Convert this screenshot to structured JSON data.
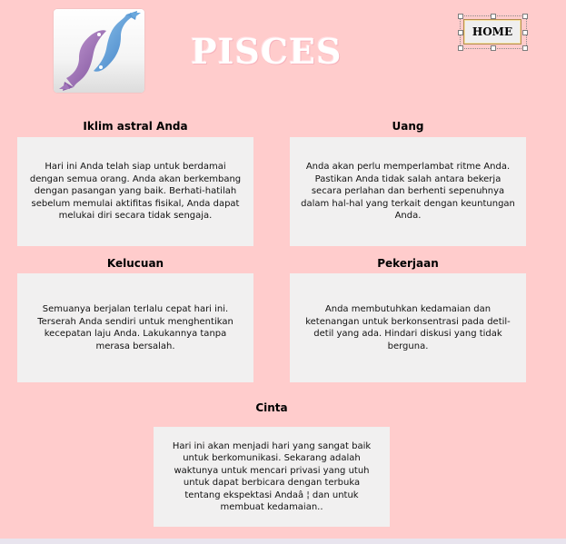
{
  "header": {
    "title": "PISCES",
    "home_label": "HOME"
  },
  "sections": [
    {
      "heading": "Iklim astral Anda",
      "body": "Hari ini Anda telah siap untuk berdamai dengan semua orang. Anda akan berkembang dengan pasangan yang baik. Berhati-hatilah sebelum memulai aktifitas fisikal, Anda dapat melukai diri secara tidak sengaja."
    },
    {
      "heading": "Uang",
      "body": "Anda akan perlu memperlambat ritme Anda. Pastikan Anda tidak salah antara bekerja secara perlahan dan berhenti sepenuhnya dalam hal-hal yang terkait dengan keuntungan Anda."
    },
    {
      "heading": "Kelucuan",
      "body": "Semuanya berjalan terlalu cepat hari ini. Terserah Anda sendiri untuk menghentikan kecepatan laju Anda. Lakukannya tanpa merasa bersalah."
    },
    {
      "heading": "Pekerjaan",
      "body": "Anda membutuhkan kedamaian dan ketenangan untuk berkonsentrasi pada detil-detil yang ada. Hindari diskusi yang tidak berguna."
    },
    {
      "heading": "Cinta",
      "body": "Hari ini akan menjadi hari yang sangat baik untuk berkomunikasi. Sekarang adalah waktunya untuk mencari privasi yang utuh untuk dapat berbicara dengan terbuka tentang ekspektasi Andaâ ¦ dan untuk membuat kedamaian.."
    }
  ],
  "colors": {
    "background": "#ffcccc",
    "panel": "#f1f0f0",
    "fish_purple": "#9a6bb0",
    "fish_blue": "#5b9bd5"
  },
  "icons": {
    "logo": "pisces-fish-icon"
  }
}
